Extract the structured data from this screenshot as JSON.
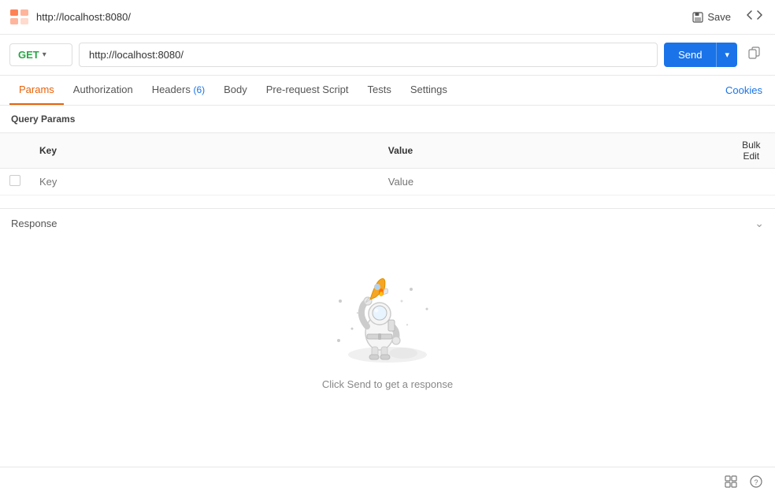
{
  "topbar": {
    "url": "http://localhost:8080/",
    "save_label": "Save",
    "save_icon": "floppy-icon",
    "code_icon": "code-icon"
  },
  "request": {
    "method": "GET",
    "url": "http://localhost:8080/",
    "send_label": "Send"
  },
  "tabs": [
    {
      "id": "params",
      "label": "Params",
      "active": true,
      "badge": null
    },
    {
      "id": "authorization",
      "label": "Authorization",
      "active": false,
      "badge": null
    },
    {
      "id": "headers",
      "label": "Headers",
      "active": false,
      "badge": "6"
    },
    {
      "id": "body",
      "label": "Body",
      "active": false,
      "badge": null
    },
    {
      "id": "pre-request-script",
      "label": "Pre-request Script",
      "active": false,
      "badge": null
    },
    {
      "id": "tests",
      "label": "Tests",
      "active": false,
      "badge": null
    },
    {
      "id": "settings",
      "label": "Settings",
      "active": false,
      "badge": null
    }
  ],
  "cookies_label": "Cookies",
  "query_params": {
    "section_title": "Query Params",
    "columns": {
      "key": "Key",
      "value": "Value",
      "bulk_edit": "Bulk Edit"
    },
    "rows": [
      {
        "key": "",
        "value": ""
      }
    ],
    "key_placeholder": "Key",
    "value_placeholder": "Value"
  },
  "response": {
    "title": "Response",
    "empty_text": "Click Send to get a response"
  },
  "bottom": {
    "grid_icon": "grid-icon",
    "help_icon": "help-icon"
  }
}
